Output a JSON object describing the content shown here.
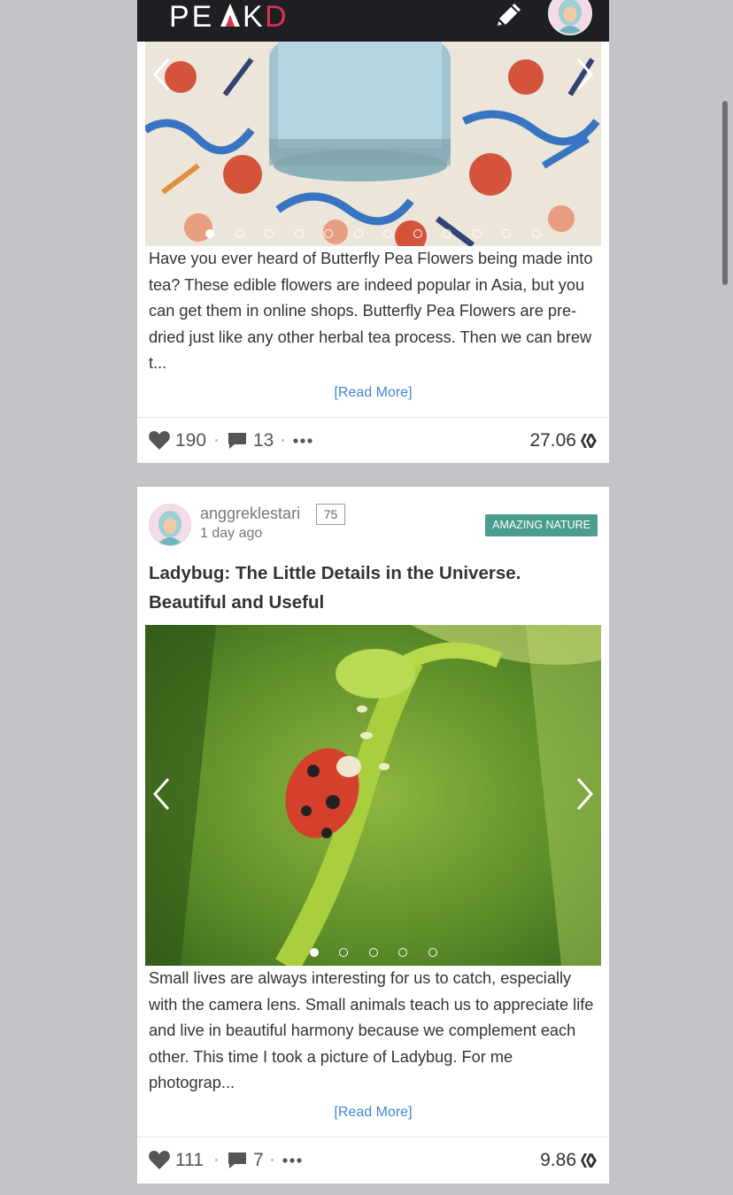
{
  "header": {
    "logo_text": "PEAKD",
    "edit_icon": "pencil-icon",
    "avatar_icon": "user-avatar"
  },
  "posts": [
    {
      "image_slides": 12,
      "active_slide": 1,
      "excerpt": "Have you ever heard of Butterfly Pea Flowers being made into tea? These edible flowers are indeed popular in Asia, but you can get them in online shops. Butterfly Pea Flowers are pre-dried just like any other herbal tea process. Then we can brew t...",
      "read_more": "[Read More]",
      "votes": "190",
      "comments": "13",
      "payout": "27.06"
    },
    {
      "author": "anggreklestari",
      "reputation": "75",
      "time": "1 day ago",
      "tag": "AMAZING NATURE",
      "title": "Ladybug: The Little Details in the Universe. Beautiful and Useful",
      "image_slides": 5,
      "active_slide": 1,
      "excerpt": "Small lives are always interesting for us to catch, especially with the camera lens. Small animals teach us to appreciate life and live in beautiful harmony because we complement each other. This time I took a picture of Ladybug. For me photograp...",
      "read_more": "[Read More]",
      "votes": "111",
      "comments": "7",
      "payout": "9.86"
    }
  ],
  "colors": {
    "header_bg": "#1e1f23",
    "accent_red": "#e0314b",
    "link_blue": "#3f87d6",
    "tag_bg": "#4a9d8f"
  }
}
